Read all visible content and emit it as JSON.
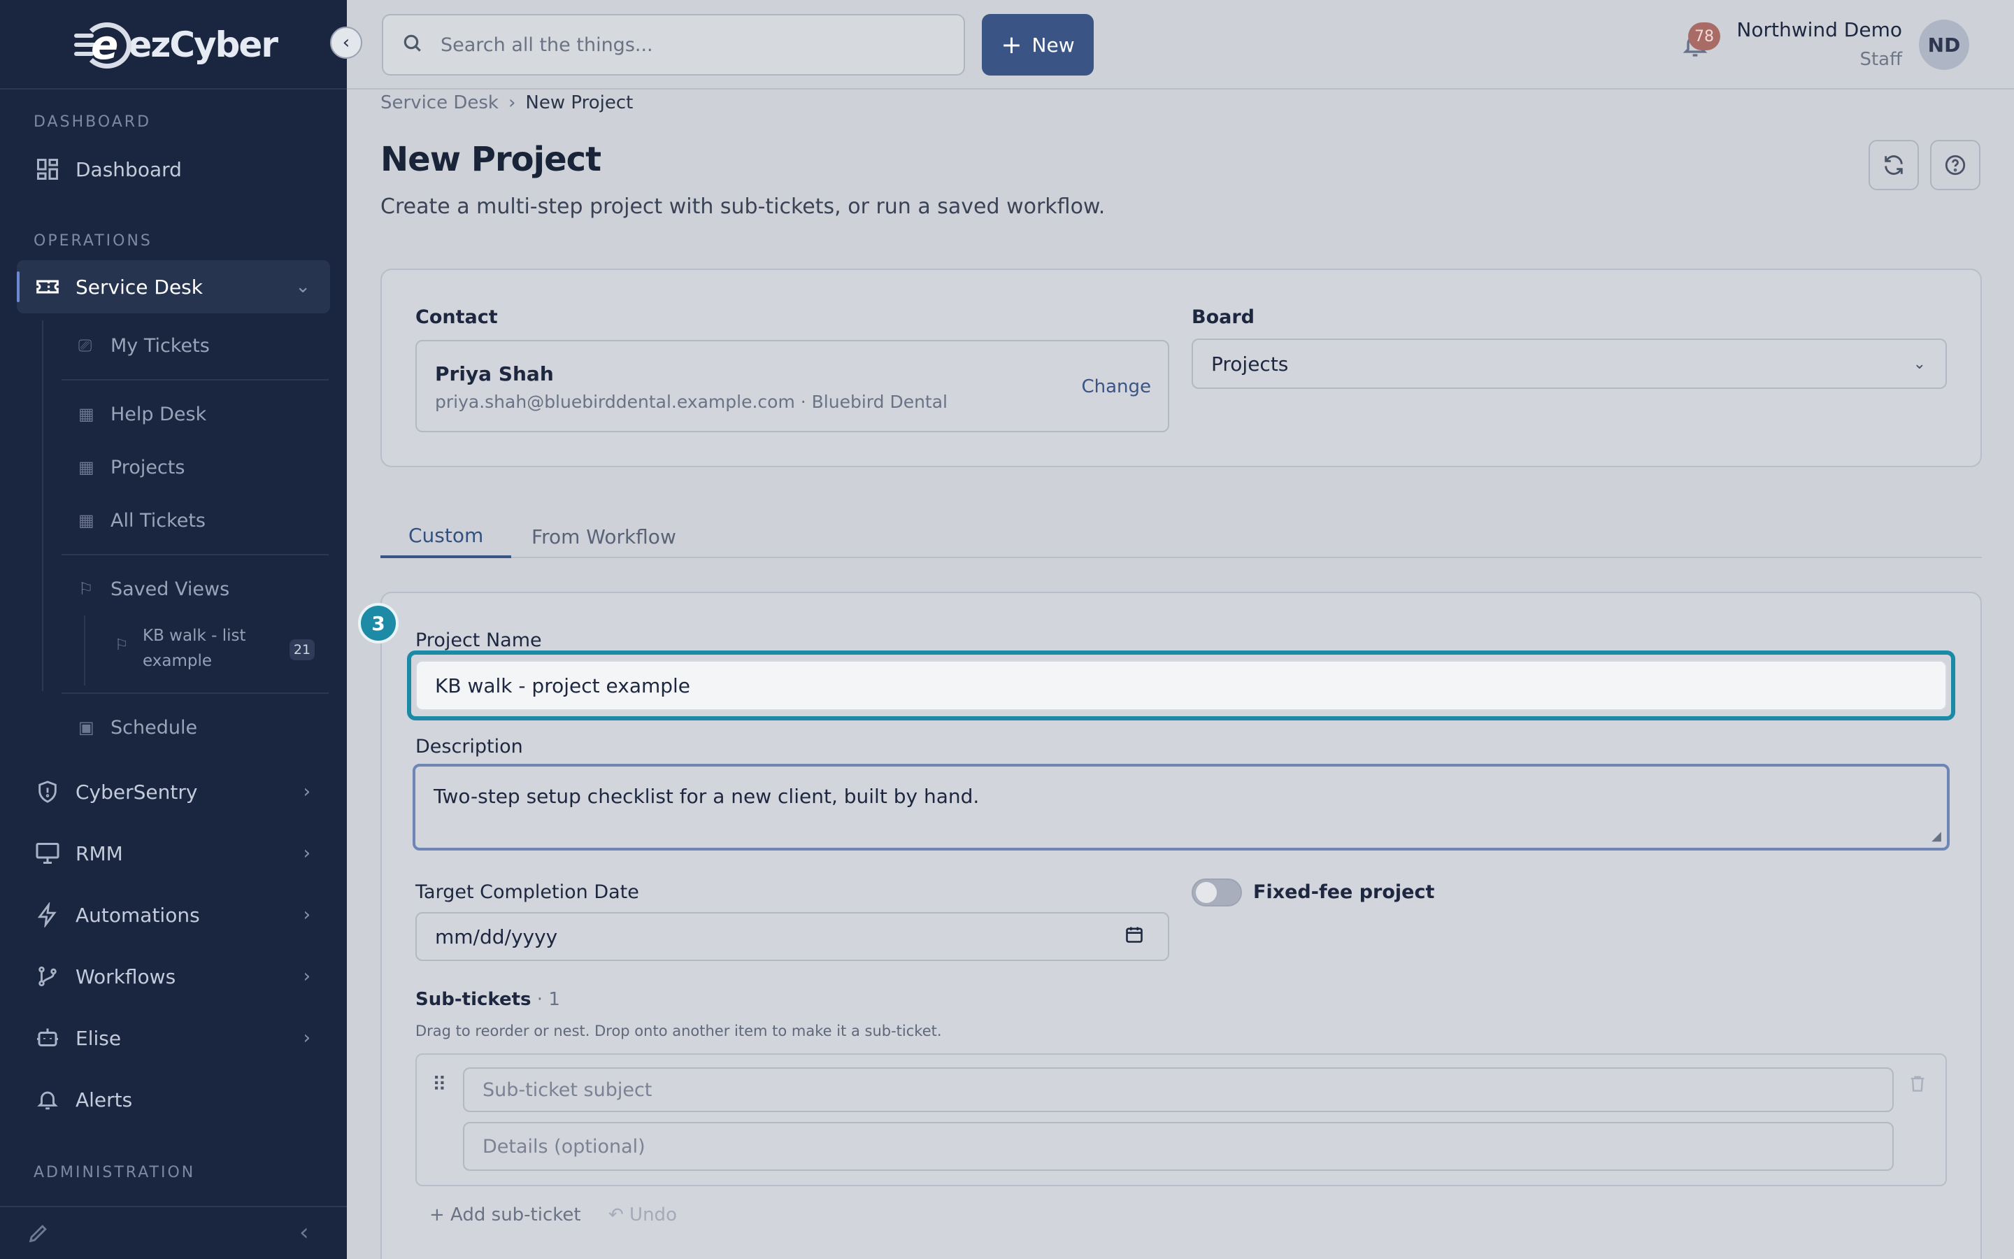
{
  "brand": {
    "logo_text": "ezCyber"
  },
  "sidebar": {
    "sections": {
      "dashboard": "DASHBOARD",
      "operations": "OPERATIONS",
      "administration": "ADMINISTRATION"
    },
    "items": {
      "dashboard": "Dashboard",
      "service_desk": "Service Desk",
      "cybersentry": "CyberSentry",
      "rmm": "RMM",
      "automations": "Automations",
      "workflows": "Workflows",
      "elise": "Elise",
      "alerts": "Alerts"
    },
    "subitems": {
      "my_tickets": "My Tickets",
      "help_desk": "Help Desk",
      "projects": "Projects",
      "all_tickets": "All Tickets",
      "saved_views": "Saved Views",
      "kb_walk_line1": "KB walk - list",
      "kb_walk_line2": "example",
      "kb_walk_count": "21",
      "schedule": "Schedule"
    }
  },
  "topbar": {
    "search_placeholder": "Search all the things...",
    "new_button": "New",
    "notification_count": "78",
    "user_name": "Northwind Demo",
    "user_role": "Staff",
    "avatar_initials": "ND"
  },
  "breadcrumb": {
    "parent": "Service Desk",
    "separator": "›",
    "current": "New Project"
  },
  "page": {
    "title": "New Project",
    "subtitle": "Create a multi-step project with sub-tickets, or run a saved workflow."
  },
  "contact": {
    "label": "Contact",
    "name": "Priya Shah",
    "info": "priya.shah@bluebirddental.example.com · Bluebird Dental",
    "change": "Change"
  },
  "board": {
    "label": "Board",
    "value": "Projects"
  },
  "tabs": {
    "custom": "Custom",
    "from_workflow": "From Workflow"
  },
  "form": {
    "step_number": "3",
    "project_name_label": "Project Name",
    "project_name_value": "KB walk - project example",
    "description_label": "Description",
    "description_value": "Two-step setup checklist for a new client, built by hand.",
    "target_date_label": "Target Completion Date",
    "target_date_placeholder": "mm/dd/yyyy",
    "fixed_fee_label": "Fixed-fee project",
    "fixed_fee_on": false,
    "subtickets_label": "Sub-tickets",
    "subtickets_count": "· 1",
    "subtickets_hint": "Drag to reorder or nest. Drop onto another item to make it a sub-ticket.",
    "subticket_subject_placeholder": "Sub-ticket subject",
    "subticket_details_placeholder": "Details (optional)",
    "add_subticket": "+ Add sub-ticket",
    "undo": "↶ Undo"
  },
  "colors": {
    "sidebar_bg": "#1a2540",
    "accent": "#3b5486",
    "highlight": "#1b8aa7"
  }
}
